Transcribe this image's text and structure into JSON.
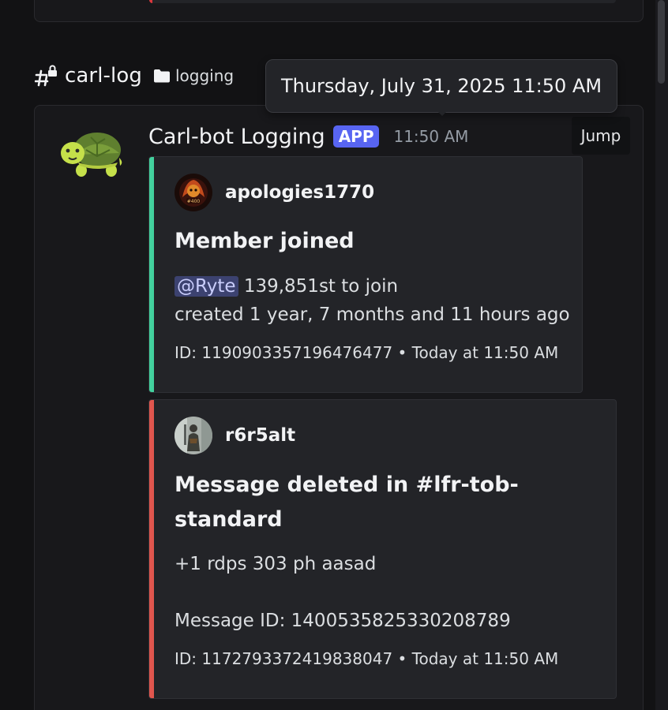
{
  "channel": {
    "name": "carl-log",
    "category": "logging"
  },
  "tooltip": {
    "text": "Thursday, July 31, 2025 11:50 AM"
  },
  "message": {
    "author": "Carl-bot Logging",
    "badge": "APP",
    "time": "11:50 AM",
    "jump_label": "Jump"
  },
  "embeds": [
    {
      "color": "#43d19e",
      "author": "apologies1770",
      "title": "Member joined",
      "mention": "@Ryte",
      "join_text": "139,851st to join",
      "created_text": "created 1 year, 7 months and 11 hours ago",
      "footer": "ID: 1190903357196476477 • Today at 11:50 AM"
    },
    {
      "color": "#e0564e",
      "author": "r6r5alt",
      "title_line1": "Message deleted in #lfr-tob-",
      "title_line2": "standard",
      "content": "+1 rdps 303 ph aasad",
      "message_id": "Message ID: 1400535825330208789",
      "footer": "ID: 1172793372419838047 • Today at 11:50 AM"
    }
  ],
  "colors": {
    "background": "#121214",
    "card": "#18181b",
    "embed": "#232428",
    "app_badge": "#5865f2"
  }
}
